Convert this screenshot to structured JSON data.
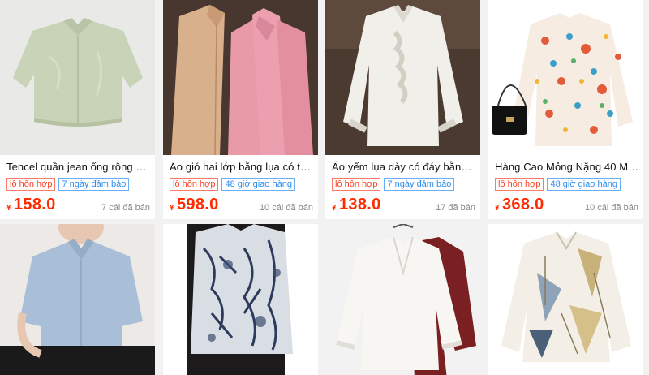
{
  "currency_symbol": "¥",
  "products": [
    {
      "title": "Tencel quần jean ống rộng mề...",
      "tag1": "lô hỗn hợp",
      "tag2": "7 ngày đảm bảo",
      "price": "158.0",
      "sold": "7 cái đã bán",
      "image_alt": "mint-green-shirt"
    },
    {
      "title": "Áo gió hai lớp bằng lụa có thể t...",
      "tag1": "lô hỗn hợp",
      "tag2": "48 giờ giao hàng",
      "price": "598.0",
      "sold": "10 cái đã bán",
      "image_alt": "beige-and-pink-silk-shirts"
    },
    {
      "title": "Áo yếm lụa dày có đáy bằng lụa...",
      "tag1": "lô hỗn hợp",
      "tag2": "7 ngày đảm bảo",
      "price": "138.0",
      "sold": "17 đã bán",
      "image_alt": "white-ruffle-blouse"
    },
    {
      "title": "Hàng Cao Mỏng Nặng 40 Mm Q...",
      "tag1": "lô hỗn hợp",
      "tag2": "48 giờ giao hàng",
      "price": "368.0",
      "sold": "10 cái đã bán",
      "image_alt": "floral-print-shirt"
    },
    {
      "image_alt": "light-blue-blouse"
    },
    {
      "image_alt": "navy-print-silk-shirt"
    },
    {
      "image_alt": "white-and-burgundy-shirts"
    },
    {
      "image_alt": "geometric-print-shirt"
    }
  ],
  "colors": {
    "price": "#ff2a00",
    "tag_red": "#ff3c1e",
    "tag_blue": "#2d8cf0",
    "background": "#f2f2f2"
  }
}
